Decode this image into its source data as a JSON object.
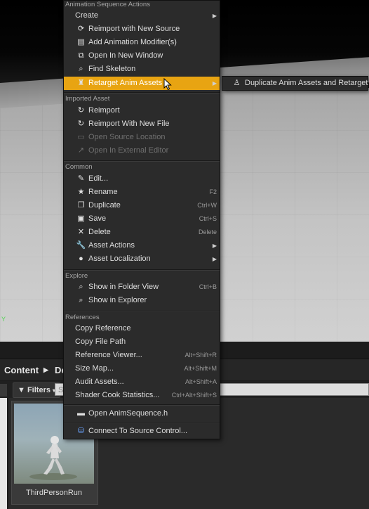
{
  "viewport": {
    "axis_label": "Y"
  },
  "content_browser": {
    "path": [
      "Content",
      "De"
    ],
    "filters_label": "Filters",
    "search_placeholder": "Se",
    "asset": {
      "name": "ThirdPersonRun"
    }
  },
  "menu": {
    "sections": {
      "animation": "Animation Sequence Actions",
      "imported": "Imported Asset",
      "common": "Common",
      "explore": "Explore",
      "references": "References"
    },
    "items": {
      "create": "Create",
      "reimport_new_source": "Reimport with New Source",
      "add_modifiers": "Add Animation Modifier(s)",
      "open_new_window": "Open In New Window",
      "find_skeleton": "Find Skeleton",
      "retarget": "Retarget Anim Assets",
      "reimport": "Reimport",
      "reimport_new_file": "Reimport With New File",
      "open_source_location": "Open Source Location",
      "open_external_editor": "Open In External Editor",
      "edit": "Edit...",
      "rename": "Rename",
      "duplicate": "Duplicate",
      "save": "Save",
      "delete": "Delete",
      "asset_actions": "Asset Actions",
      "asset_localization": "Asset Localization",
      "show_folder_view": "Show in Folder View",
      "show_explorer": "Show in Explorer",
      "copy_reference": "Copy Reference",
      "copy_file_path": "Copy File Path",
      "reference_viewer": "Reference Viewer...",
      "size_map": "Size Map...",
      "audit_assets": "Audit Assets...",
      "shader_cook_stats": "Shader Cook Statistics...",
      "open_anim_h": "Open AnimSequence.h",
      "connect_source_control": "Connect To Source Control..."
    },
    "shortcuts": {
      "rename": "F2",
      "duplicate": "Ctrl+W",
      "save": "Ctrl+S",
      "delete": "Delete",
      "show_folder_view": "Ctrl+B",
      "reference_viewer": "Alt+Shift+R",
      "size_map": "Alt+Shift+M",
      "audit_assets": "Alt+Shift+A",
      "shader_cook_stats": "Ctrl+Alt+Shift+S"
    }
  },
  "submenu": {
    "duplicate_retarget": "Duplicate Anim Assets and Retarget"
  },
  "colors": {
    "highlight": "#e8a412",
    "menu_bg": "#2b2b2b"
  }
}
